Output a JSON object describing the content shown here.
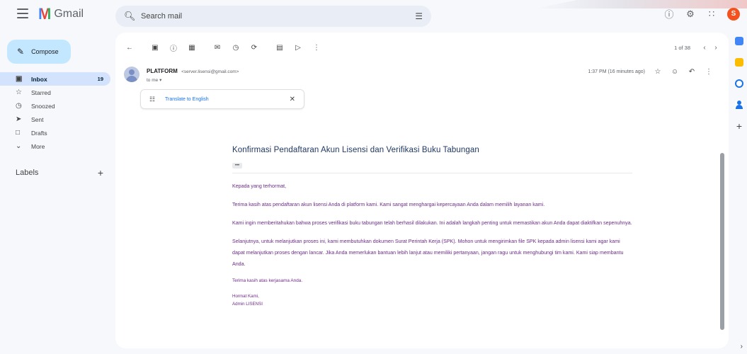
{
  "app": {
    "name": "Gmail"
  },
  "search": {
    "placeholder": "Search mail"
  },
  "compose": {
    "label": "Compose"
  },
  "nav": {
    "items": [
      {
        "label": "Inbox",
        "count": "19"
      },
      {
        "label": "Starred",
        "count": ""
      },
      {
        "label": "Snoozed",
        "count": ""
      },
      {
        "label": "Sent",
        "count": ""
      },
      {
        "label": "Drafts",
        "count": ""
      },
      {
        "label": "More",
        "count": ""
      }
    ]
  },
  "labels": {
    "title": "Labels"
  },
  "toolbar": {
    "pagination": "1 of 38"
  },
  "email": {
    "sender_name": "PLATFORM",
    "sender_email": "<server.lisensi@gmail.com>",
    "to": "to me",
    "time": "1:37 PM (16 minutes ago)",
    "translate_label": "Translate to English",
    "subject": "Konfirmasi Pendaftaran Akun Lisensi dan Verifikasi Buku Tabungan",
    "greeting": "Kepada yang terhormat,",
    "p1": "Terima kasih atas pendaftaran akun lisensi Anda di platform kami. Kami sangat menghargai kepercayaan Anda dalam memilih layanan kami.",
    "p2": "Kami ingin memberitahukan bahwa proses verifikasi buku tabungan telah berhasil dilakukan. Ini adalah langkah penting untuk memastikan akun Anda dapat diaktifkan sepenuhnya.",
    "p3": "Selanjutnya, untuk melanjutkan proses ini, kami membutuhkan dokumen Surat Perintah Kerja (SPK). Mohon untuk mengirimkan file SPK kepada admin lisensi kami agar kami dapat melanjutkan proses dengan lancar. Jika Anda memerlukan bantuan lebih lanjut atau memiliki pertanyaan, jangan ragu untuk menghubungi tim kami. Kami siap membantu Anda.",
    "thanks": "Terima kasih atas kerjasama Anda.",
    "sign1": "Hormat Kami,",
    "sign2": "Admin LISENSI"
  },
  "user": {
    "avatar_letter": "S"
  },
  "icons": {
    "menu": "hamburger-icon",
    "search": "search-icon",
    "tune": "tune-icon",
    "help": "help-icon",
    "settings": "gear-icon",
    "apps": "apps-grid-icon"
  },
  "colors": {
    "accent": "#1a73e8",
    "compose_bg": "#c2e7ff",
    "inbox_active": "#d3e3fd",
    "body_text": "#6d2a8a",
    "subject": "#1f3864"
  }
}
